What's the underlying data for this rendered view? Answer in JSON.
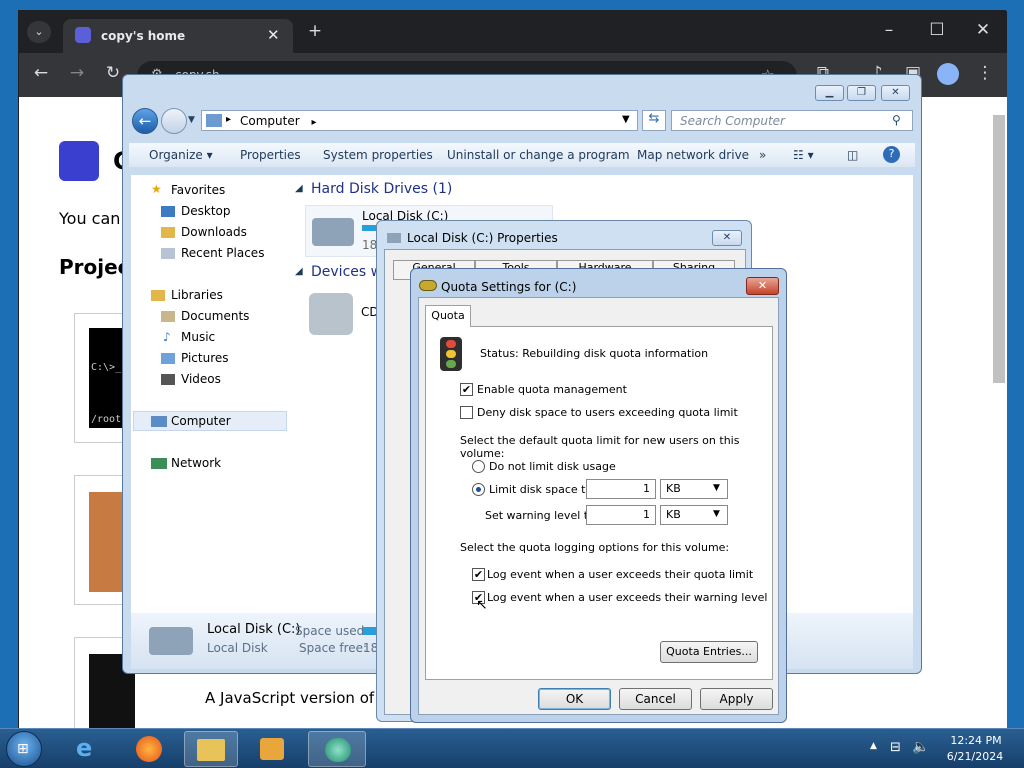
{
  "chrome": {
    "tab_title": "copy's home",
    "url": "copy.sh",
    "page_heading_initial": "C",
    "page_text": "You can c",
    "projects_heading": "Projec",
    "terminal_text_1": "C:\\>_",
    "terminal_text_2": "/root",
    "js_caption": "A JavaScript version of C"
  },
  "explorer": {
    "address": "Computer",
    "search_placeholder": "Search Computer",
    "commands": [
      "Organize",
      "Properties",
      "System properties",
      "Uninstall or change a program",
      "Map network drive"
    ],
    "more": "»",
    "nav": {
      "favorites": "Favorites",
      "desktop": "Desktop",
      "downloads": "Downloads",
      "recent": "Recent Places",
      "libraries": "Libraries",
      "documents": "Documents",
      "music": "Music",
      "pictures": "Pictures",
      "videos": "Videos",
      "computer": "Computer",
      "network": "Network"
    },
    "group_hdd": "Hard Disk Drives (1)",
    "local_disk": "Local Disk (C:)",
    "local_disk_size": "18.",
    "group_devices": "Devices w",
    "cd_label": "CD",
    "details_name": "Local Disk (C:)",
    "details_type": "Local Disk",
    "space_used_label": "Space used:",
    "space_free_label": "Space free:",
    "space_free_value": "18."
  },
  "props": {
    "title": "Local Disk (C:) Properties",
    "tabs": [
      "General",
      "Tools",
      "Hardware",
      "Sharing"
    ]
  },
  "quota": {
    "title": "Quota Settings for  (C:)",
    "tab": "Quota",
    "status": "Status:  Rebuilding disk quota information",
    "enable": "Enable quota management",
    "deny": "Deny disk space to users exceeding quota limit",
    "default_label": "Select the default quota limit for new users on this volume:",
    "no_limit": "Do not limit disk usage",
    "limit": "Limit disk space to",
    "limit_value": "1",
    "limit_unit": "KB",
    "warning": "Set warning level to",
    "warning_value": "1",
    "warning_unit": "KB",
    "logging_label": "Select the quota logging options for this volume:",
    "log_limit": "Log event when a user exceeds their quota limit",
    "log_warning": "Log event when a user exceeds their warning level",
    "entries_btn": "Quota Entries...",
    "ok": "OK",
    "cancel": "Cancel",
    "apply": "Apply",
    "enable_checked": true,
    "deny_checked": false,
    "log_limit_checked": true,
    "log_warning_checked": true
  },
  "taskbar": {
    "time": "12:24 PM",
    "date": "6/21/2024"
  }
}
